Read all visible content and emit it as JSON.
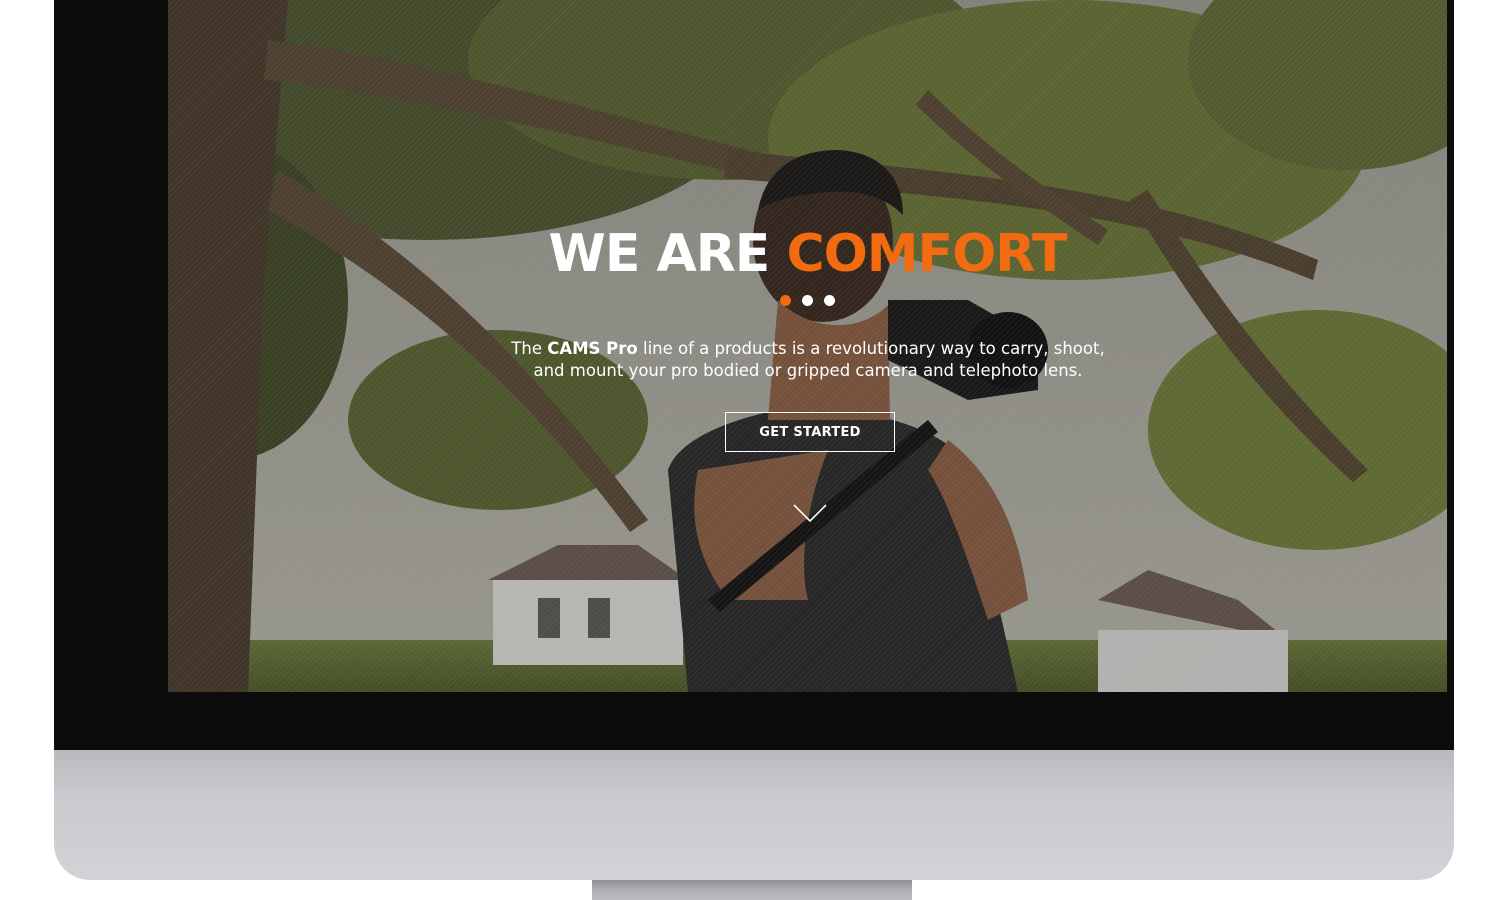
{
  "hero": {
    "title_white": "WE ARE",
    "title_accent": "COMFORT",
    "accent_color": "#f26b10",
    "slider": {
      "dot_count": 3,
      "active_index": 0
    },
    "description_pre": "The",
    "description_bold": "CAMS Pro",
    "description_line1_rest": "line of a products is a revolutionary way to carry, shoot,",
    "description_line2": "and mount your pro bodied or gripped camera and telephoto lens.",
    "cta_label": "GET STARTED",
    "scroll_icon": "chevron-down-icon"
  },
  "background": {
    "scene": "photographer holding camera under trees in front of house"
  }
}
